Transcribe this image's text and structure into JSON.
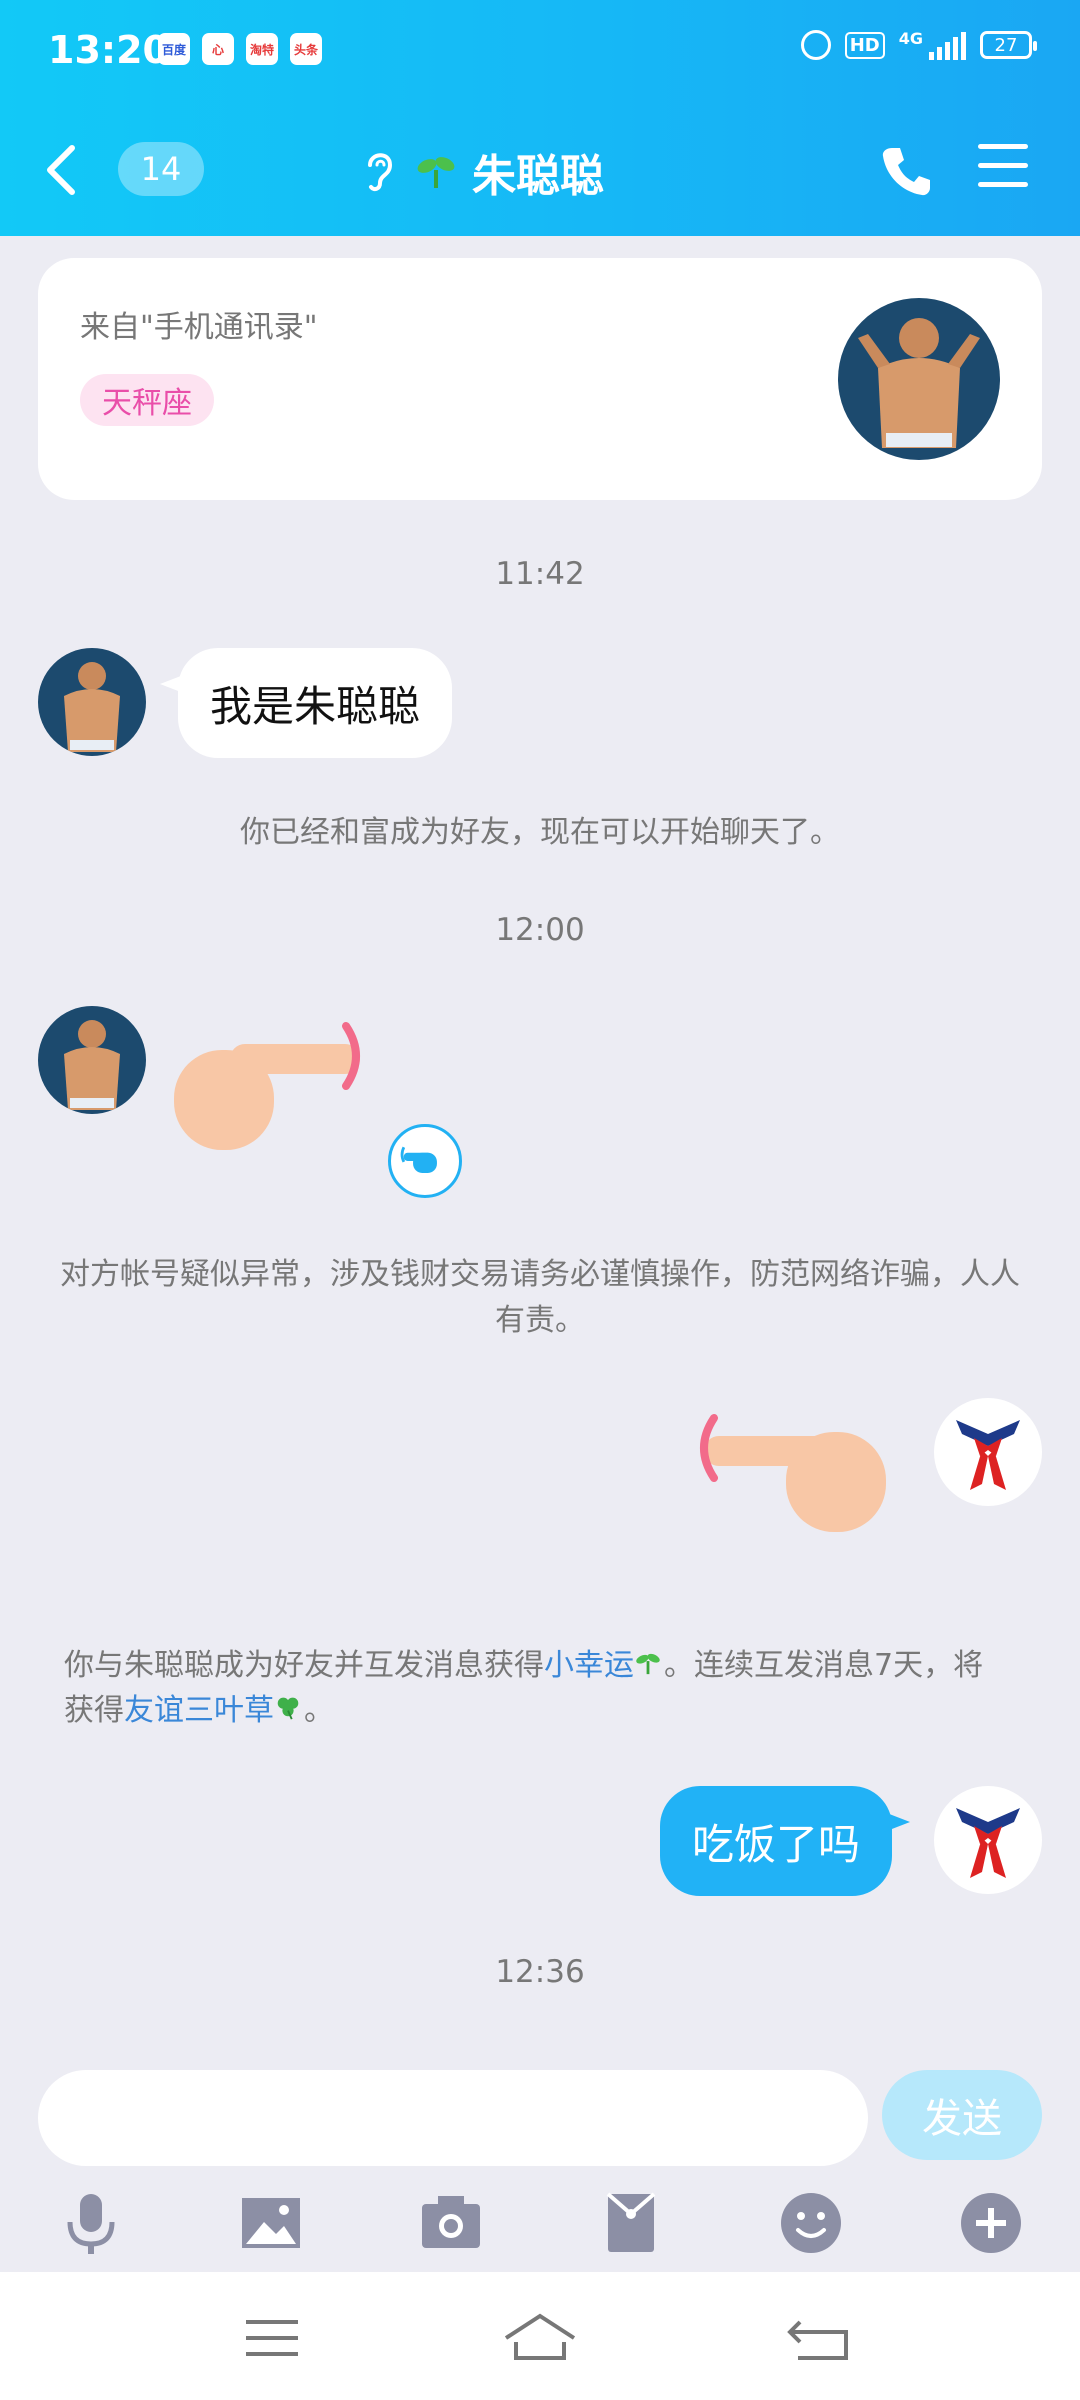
{
  "status_bar": {
    "time": "13:20",
    "app_icons": [
      "百度",
      "心",
      "淘特",
      "头条"
    ],
    "hd": "HD",
    "network": "4G",
    "battery": "27"
  },
  "header": {
    "unread_count": "14",
    "title": "朱聪聪",
    "background": "#16b8f6"
  },
  "profile_card": {
    "source": "来自\"手机通讯录\"",
    "zodiac": "天秤座"
  },
  "messages": {
    "ts1": "11:42",
    "msg1": "我是朱聪聪",
    "sys1": "你已经和富成为好友，现在可以开始聊天了。",
    "ts2": "12:00",
    "sys2": "对方帐号疑似异常，涉及钱财交易请务必谨慎操作，防范网络诈骗，人人有责。",
    "sys3": {
      "part1": "你与朱聪聪成为好友并互发消息获得",
      "link1": "小幸运",
      "part2": "。连续互发消息7天，将获得",
      "link2": "友谊三叶草",
      "part3": "。"
    },
    "msg2": "吃饭了吗",
    "ts3": "12:36"
  },
  "composer": {
    "input_value": "",
    "send_label": "发送"
  },
  "toolbar_icons": [
    "microphone-icon",
    "image-icon",
    "camera-icon",
    "red-packet-icon",
    "emoji-icon",
    "plus-icon"
  ],
  "colors": {
    "accent": "#21b2f6",
    "link": "#3a87d8",
    "zodiac_tag": "#e94ea9"
  }
}
